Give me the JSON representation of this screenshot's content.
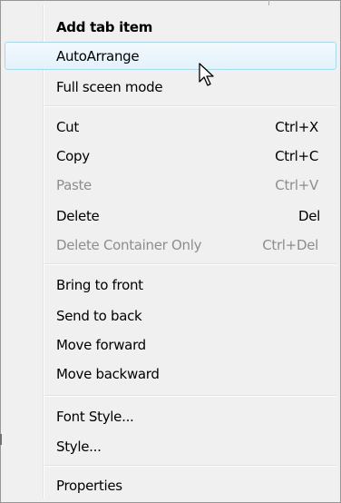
{
  "menu": {
    "items": [
      {
        "label": "Add tab item",
        "shortcut": ""
      },
      {
        "label": "AutoArrange",
        "shortcut": ""
      },
      {
        "label": "Full sceen mode",
        "shortcut": ""
      },
      {
        "label": "Cut",
        "shortcut": "Ctrl+X"
      },
      {
        "label": "Copy",
        "shortcut": "Ctrl+C"
      },
      {
        "label": "Paste",
        "shortcut": "Ctrl+V"
      },
      {
        "label": "Delete",
        "shortcut": "Del"
      },
      {
        "label": "Delete Container Only",
        "shortcut": "Ctrl+Del"
      },
      {
        "label": "Bring to front",
        "shortcut": ""
      },
      {
        "label": "Send to back",
        "shortcut": ""
      },
      {
        "label": "Move forward",
        "shortcut": ""
      },
      {
        "label": "Move backward",
        "shortcut": ""
      },
      {
        "label": "Font Style...",
        "shortcut": ""
      },
      {
        "label": "Style...",
        "shortcut": ""
      },
      {
        "label": "Properties",
        "shortcut": ""
      }
    ],
    "bold_item": "Add tab item",
    "hovered_item": "AutoArrange",
    "disabled_items": [
      "Paste",
      "Delete Container Only"
    ]
  },
  "colors": {
    "menu_background": "#f0f0f0",
    "hover_border": "#a8d8eb",
    "disabled_text": "#8d8d8d"
  },
  "cursor": {
    "icon": "arrow-pointer-icon"
  }
}
